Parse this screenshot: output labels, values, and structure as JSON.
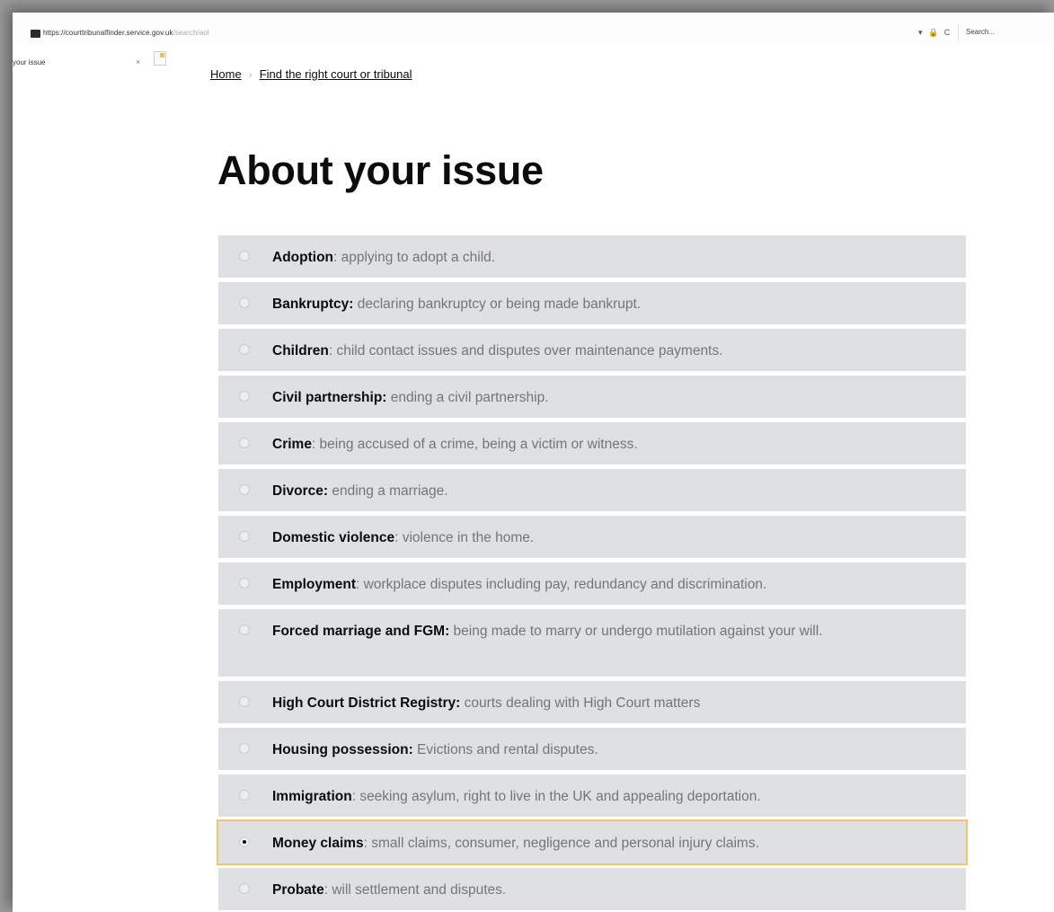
{
  "browser": {
    "url_main": "https://courttribunalfinder.service.gov.uk",
    "url_path": "/search/aol",
    "controls": [
      "▾",
      "🔒",
      "C"
    ],
    "search_placeholder": "Search...",
    "tab_label": "your issue",
    "tab_close": "×"
  },
  "breadcrumb": {
    "home": "Home",
    "separator": "›",
    "current": "Find the right court or tribunal"
  },
  "page": {
    "title": "About your issue"
  },
  "options": [
    {
      "term": "Adoption",
      "desc": ": applying to adopt a child.",
      "checked": false
    },
    {
      "term": "Bankruptcy:",
      "desc": " declaring bankruptcy or being made bankrupt.",
      "checked": false
    },
    {
      "term": "Children",
      "desc": ": child contact issues and disputes over maintenance payments.",
      "checked": false
    },
    {
      "term": "Civil partnership:",
      "desc": " ending a civil partnership.",
      "checked": false
    },
    {
      "term": "Crime",
      "desc": ": being accused of a crime, being a victim or witness.",
      "checked": false
    },
    {
      "term": "Divorce:",
      "desc": " ending a marriage.",
      "checked": false
    },
    {
      "term": "Domestic violence",
      "desc": ": violence in the home.",
      "checked": false
    },
    {
      "term": "Employment",
      "desc": ": workplace disputes including pay, redundancy and discrimination.",
      "checked": false
    },
    {
      "term": "Forced marriage and FGM:",
      "desc": " being made to marry or undergo mutilation against your will.",
      "checked": false
    },
    {
      "term": "High Court District Registry:",
      "desc": " courts dealing with High Court matters",
      "checked": false
    },
    {
      "term": "Housing possession:",
      "desc": " Evictions and rental disputes.",
      "checked": false
    },
    {
      "term": "Immigration",
      "desc": ": seeking asylum, right to live in the UK and appealing deportation.",
      "checked": false
    },
    {
      "term": "Money claims",
      "desc": ": small claims, consumer, negligence and personal injury claims.",
      "checked": true
    },
    {
      "term": "Probate",
      "desc": ": will settlement and disputes.",
      "checked": false
    }
  ],
  "colors": {
    "option_background": "#dee0e2",
    "focus_outline": "#f4c36a",
    "description_text": "#6f777b",
    "heading_text": "#0b0c0c"
  }
}
